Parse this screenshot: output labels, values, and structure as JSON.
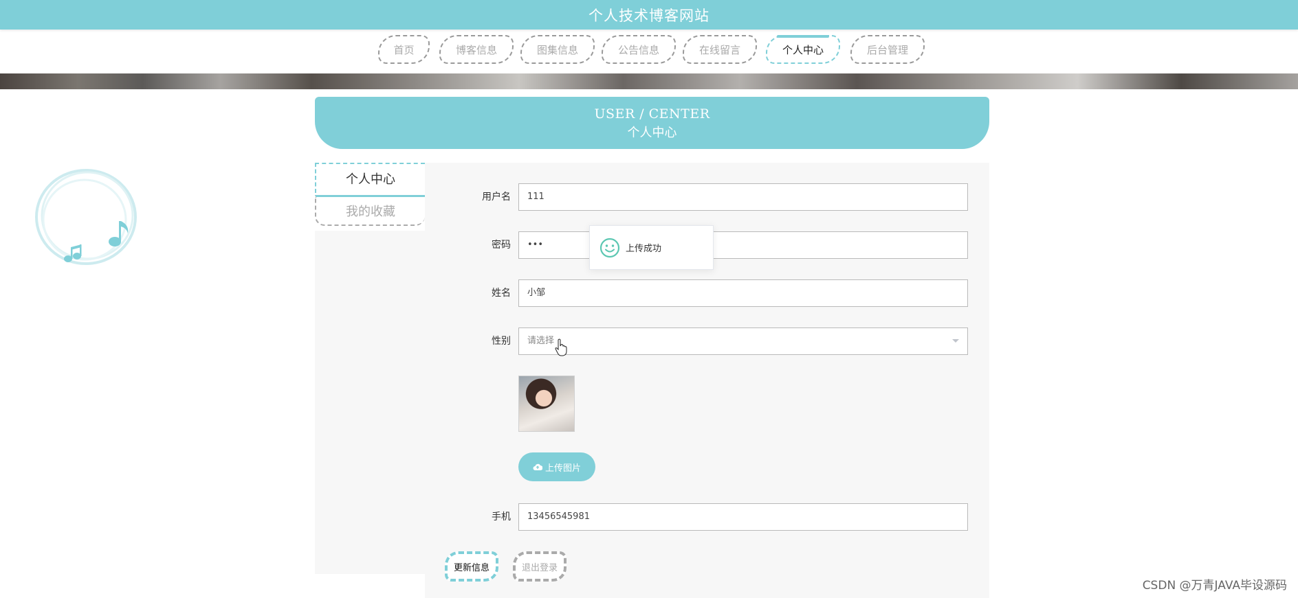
{
  "site": {
    "title": "个人技术博客网站"
  },
  "nav": {
    "items": [
      {
        "label": "首页"
      },
      {
        "label": "博客信息"
      },
      {
        "label": "图集信息"
      },
      {
        "label": "公告信息"
      },
      {
        "label": "在线留言"
      },
      {
        "label": "个人中心"
      },
      {
        "label": "后台管理"
      }
    ],
    "active_index": 5
  },
  "section": {
    "title_en": "USER / CENTER",
    "title_cn": "个人中心"
  },
  "side_menu": {
    "items": [
      {
        "label": "个人中心"
      },
      {
        "label": "我的收藏"
      }
    ],
    "active_index": 0
  },
  "form": {
    "username": {
      "label": "用户名",
      "value": "111"
    },
    "password": {
      "label": "密码",
      "value": "•••"
    },
    "name": {
      "label": "姓名",
      "value": "小邹"
    },
    "gender": {
      "label": "性别",
      "placeholder": "请选择"
    },
    "upload_button": "上传图片",
    "phone": {
      "label": "手机",
      "value": "13456545981"
    },
    "update_button": "更新信息",
    "logout_button": "退出登录"
  },
  "toast": {
    "message": "上传成功"
  },
  "watermark": "CSDN @万青JAVA毕设源码",
  "colors": {
    "accent": "#7fcfd8",
    "muted": "#aaaaaa",
    "panel": "#f7f7f7"
  },
  "icons": {
    "toast": "smile-icon",
    "upload": "cloud-upload-icon",
    "select": "chevron-down-icon",
    "cursor": "hand-pointer-icon",
    "decoration": "music-note-icon"
  }
}
